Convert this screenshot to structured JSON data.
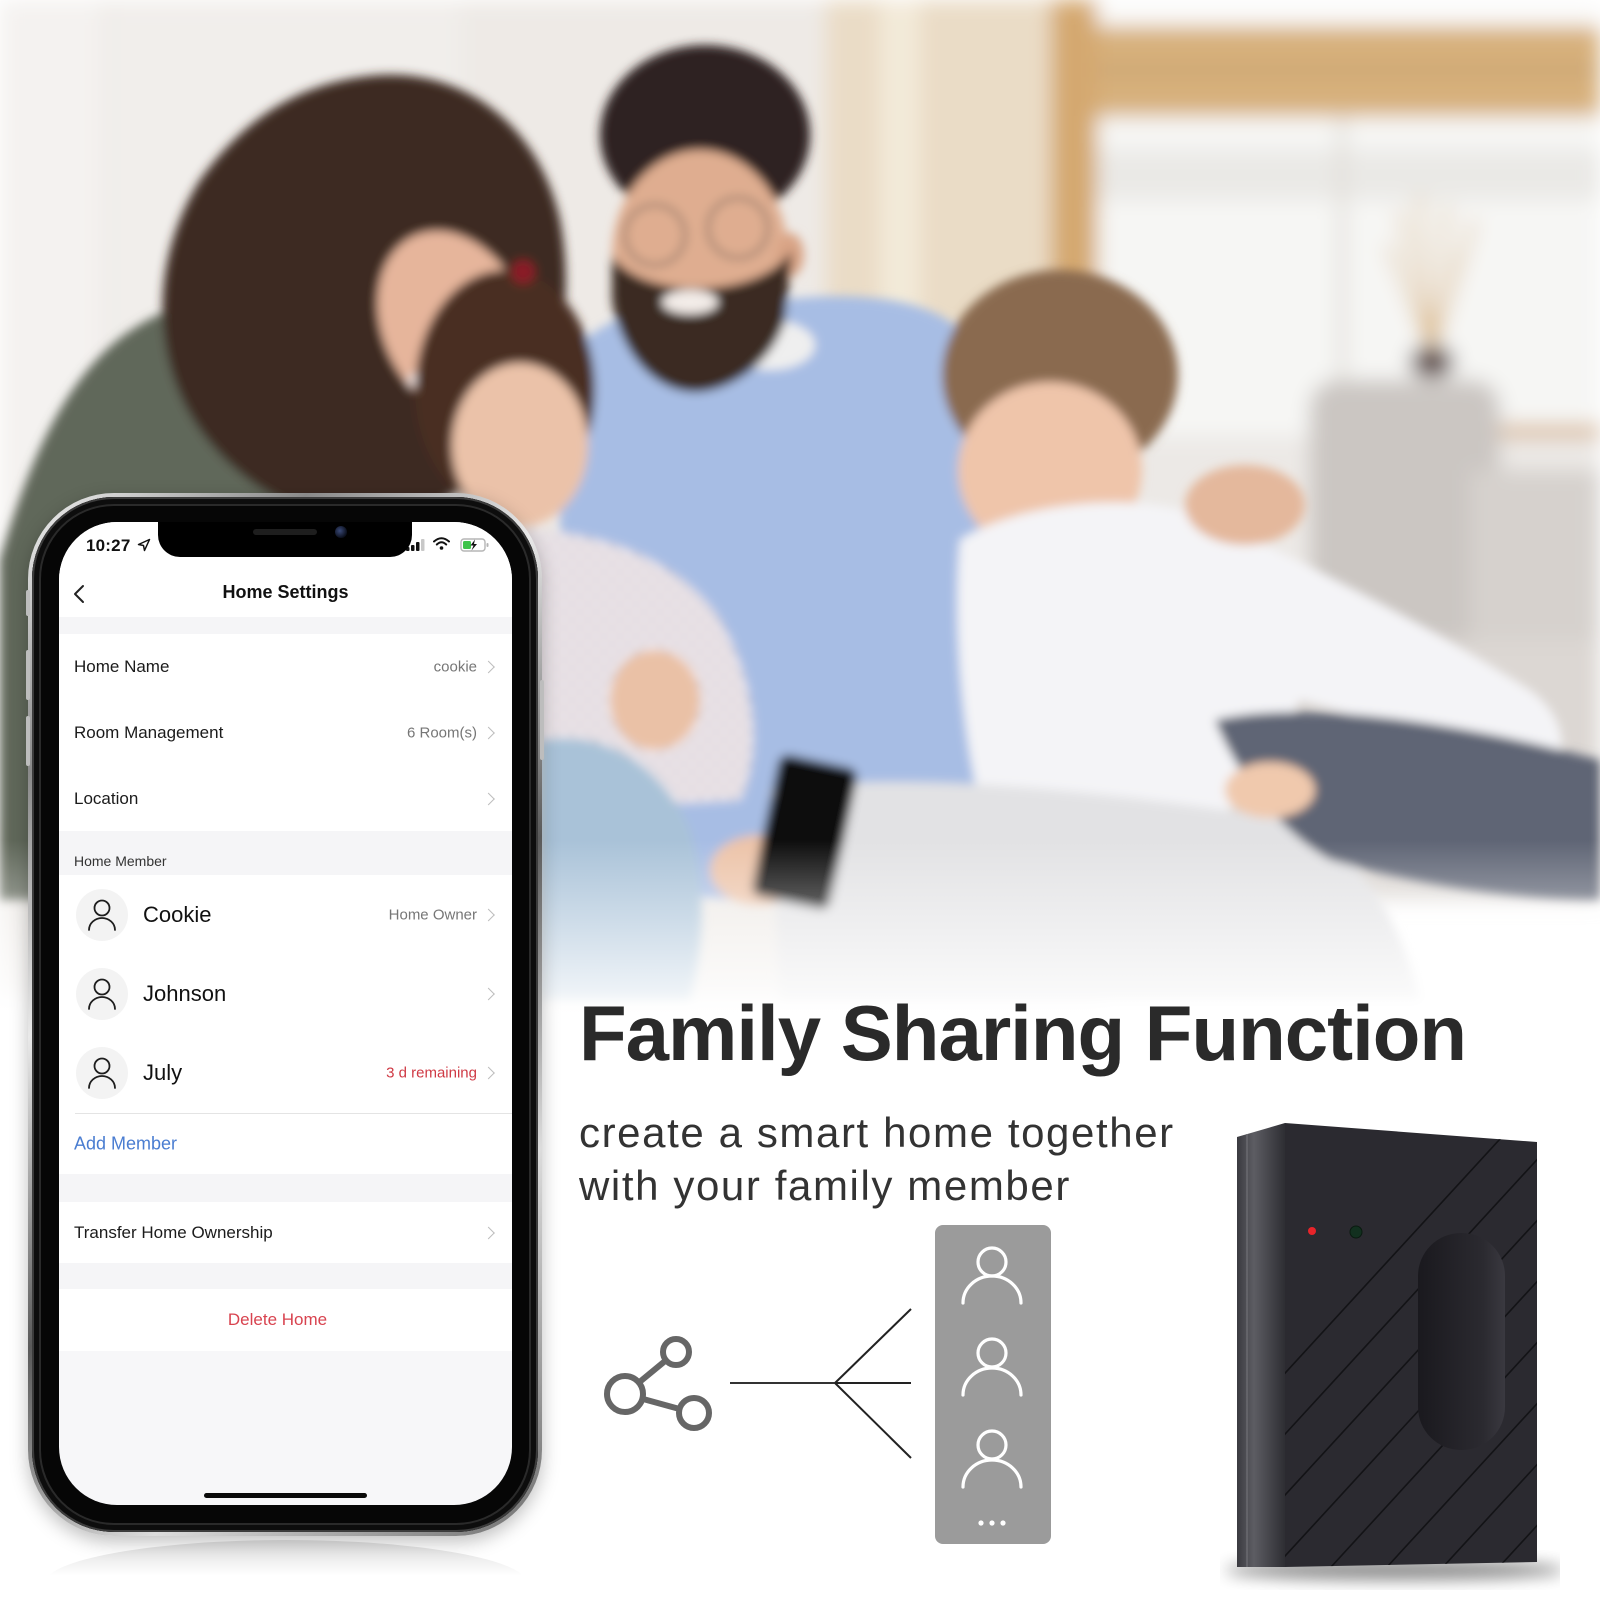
{
  "page": {
    "headline": "Family Sharing Function",
    "subtitle": [
      "create a smart home together",
      "with your family member"
    ]
  },
  "phone": {
    "status_bar": {
      "time": "10:27",
      "icons": [
        "location-arrow-icon",
        "cellular-signal-icon",
        "wifi-icon",
        "battery-charging-icon"
      ]
    },
    "nav": {
      "title": "Home Settings",
      "back_icon": "chevron-left-icon"
    },
    "settings": [
      {
        "label": "Home Name",
        "value": "cookie"
      },
      {
        "label": "Room Management",
        "value": "6 Room(s)"
      },
      {
        "label": "Location"
      }
    ],
    "members": {
      "header": "Home Member",
      "list": [
        {
          "name": "Cookie",
          "status": "Home Owner",
          "avatar_icon": "user-icon"
        },
        {
          "name": "Johnson",
          "avatar_icon": "user-icon"
        },
        {
          "name": "July",
          "status": "3 d remaining",
          "status_type": "warning",
          "avatar_icon": "user-icon"
        }
      ],
      "add_label": "Add Member"
    },
    "transfer_label": "Transfer Home Ownership",
    "delete_label": "Delete Home"
  },
  "diagram": {
    "source_icon": "share-icon",
    "member_icons": [
      "user-icon",
      "user-icon",
      "user-icon"
    ],
    "more_icon": "ellipsis-icon"
  },
  "product": {
    "indicator_leds": [
      {
        "color": "#e8242a"
      },
      {
        "color": "#12301f"
      }
    ]
  },
  "colors": {
    "accent_blue": "#4a7dd1",
    "danger_red": "#d8434f",
    "warning_red": "#cf3a45",
    "headline": "#2a2a2a",
    "panel_gray": "#9b9b9b",
    "share_icon_gray": "#666666",
    "device_body": "#2b2a30"
  }
}
